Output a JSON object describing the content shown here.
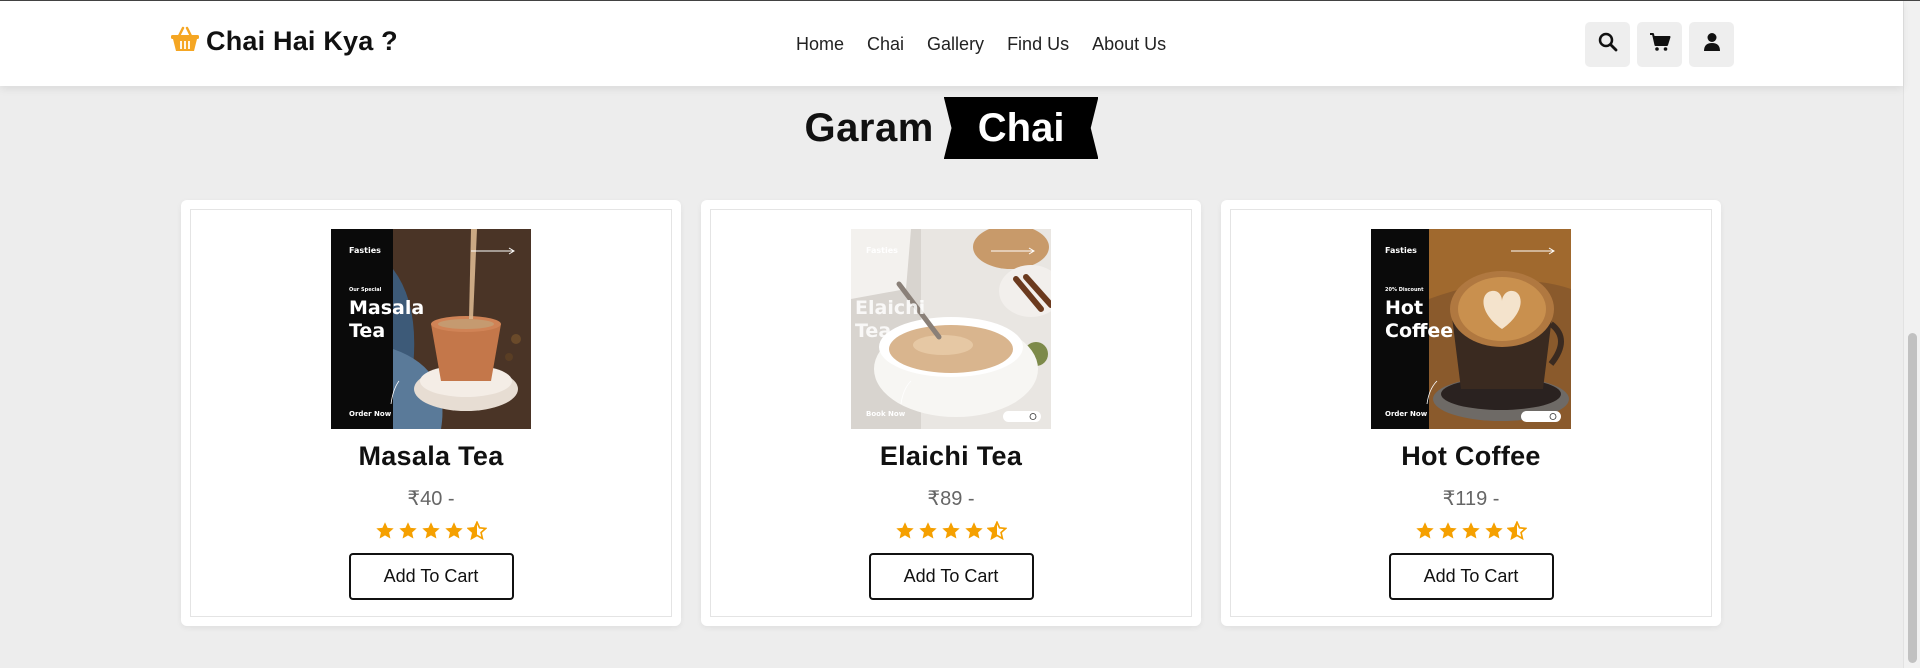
{
  "brand": {
    "name": "Chai Hai Kya ?",
    "icon": "basket-icon",
    "icon_color": "#f5a623"
  },
  "nav": [
    {
      "label": "Home"
    },
    {
      "label": "Chai"
    },
    {
      "label": "Gallery"
    },
    {
      "label": "Find Us"
    },
    {
      "label": "About Us"
    }
  ],
  "actions": [
    {
      "icon": "search-icon"
    },
    {
      "icon": "cart-icon"
    },
    {
      "icon": "user-icon"
    }
  ],
  "heading": {
    "word": "Garam",
    "highlight": "Chai"
  },
  "products": [
    {
      "name": "Masala Tea",
      "price": "₹40 -",
      "rating": 4.5,
      "button": "Add To Cart",
      "image": {
        "brand": "Fasties",
        "tag": "Our Special",
        "title_line1": "Masala",
        "title_line2": "Tea",
        "cta": "Order Now"
      }
    },
    {
      "name": "Elaichi Tea",
      "price": "₹89 -",
      "rating": 4.5,
      "button": "Add To Cart",
      "image": {
        "brand": "Fasties",
        "tag": "",
        "title_line1": "Elaichi",
        "title_line2": "Tea",
        "cta": "Book Now"
      }
    },
    {
      "name": "Hot Coffee",
      "price": "₹119 -",
      "rating": 4.5,
      "button": "Add To Cart",
      "image": {
        "brand": "Fasties",
        "tag": "20% Discount",
        "title_line1": "Hot",
        "title_line2": "Coffee",
        "cta": "Order Now"
      }
    }
  ],
  "colors": {
    "star": "#f5a000",
    "background": "#ededed",
    "ribbon": "#000000"
  }
}
